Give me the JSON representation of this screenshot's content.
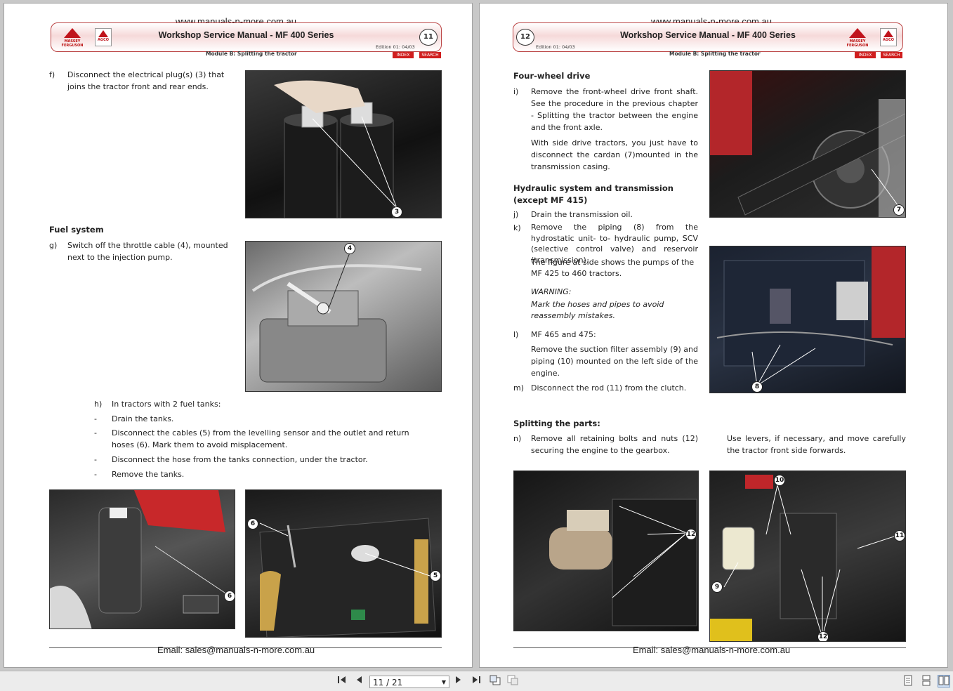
{
  "site_url": "www.manuals-n-more.com.au",
  "manual_title": "Workshop Service Manual - MF 400 Series",
  "edition": "Edition 01: 04/03",
  "module": "Module B: Splitting the tractor",
  "index_label": "INDEX",
  "search_label": "SEARCH",
  "email_line": "Email: sales@manuals-n-more.com.au",
  "logos": {
    "massey": "MASSEY FERGUSON",
    "agco": "AGCO"
  },
  "left": {
    "page_number": "11",
    "f_label": "f)",
    "f_text": "Disconnect the electrical plug(s) (3) that joins the  tractor front and rear ends.",
    "fuel_heading": "Fuel system",
    "g_label": "g)",
    "g_text": "Switch off the throttle cable (4), mounted next to the injection pump.",
    "h_label": "h)",
    "h_text": "In tractors with 2 fuel tanks:",
    "bullets": [
      "Drain the tanks.",
      "Disconnect the cables (5) from the levelling sensor and the outlet and return hoses (6). Mark them to avoid misplacement.",
      "Disconnect the hose from the tanks connection, under the tractor.",
      "Remove the tanks."
    ],
    "bullet_mark": "-",
    "callouts": {
      "c3": "3",
      "c4": "4",
      "c6a": "6",
      "c6b": "6",
      "c5": "5"
    }
  },
  "right": {
    "page_number": "12",
    "fwd_heading": "Four-wheel drive",
    "i_label": "i)",
    "i_text": "Remove the front-wheel drive front shaft. See the procedure in the previous chapter - Splitting the  tractor between the engine and the front axle.",
    "i_text2": "With side drive tractors, you just have to disconnect the cardan (7)mounted in the transmission casing.",
    "hyd_heading": "Hydraulic system and transmission (except MF 415)",
    "j_label": "j)",
    "j_text": "Drain the transmission oil.",
    "k_label": "k)",
    "k_text": "Remove the piping (8) from the hydrostatic unit- to- hydraulic pump, SCV (selective control valve) and reservoir (transmission).",
    "k_text2": "The figure at side shows the pumps of the MF 425 to 460 tractors.",
    "warning_title": "WARNING:",
    "warning_text": "Mark the hoses and pipes to avoid reassembly mistakes.",
    "l_label": "l)",
    "l_text": "MF 465 and 475:",
    "l_text2": "Remove the suction filter assembly (9) and piping (10) mounted on the left side of the engine.",
    "m_label": "m)",
    "m_text": "Disconnect the rod (11) from the clutch.",
    "split_heading": "Splitting the parts:",
    "n_label": "n)",
    "n_text": "Remove all retaining bolts and nuts (12) securing the engine to the gearbox.",
    "n_text2": "Use levers, if necessary, and move carefully the tractor front side forwards.",
    "callouts": {
      "c7": "7",
      "c8": "8",
      "c12a": "12",
      "c10": "10",
      "c11": "11",
      "c9": "9",
      "c12b": "12"
    }
  },
  "toolbar": {
    "page_indicator": "11 / 21",
    "first_icon": "first-page-icon",
    "prev_icon": "prev-page-icon",
    "next_icon": "next-page-icon",
    "last_icon": "last-page-icon"
  }
}
